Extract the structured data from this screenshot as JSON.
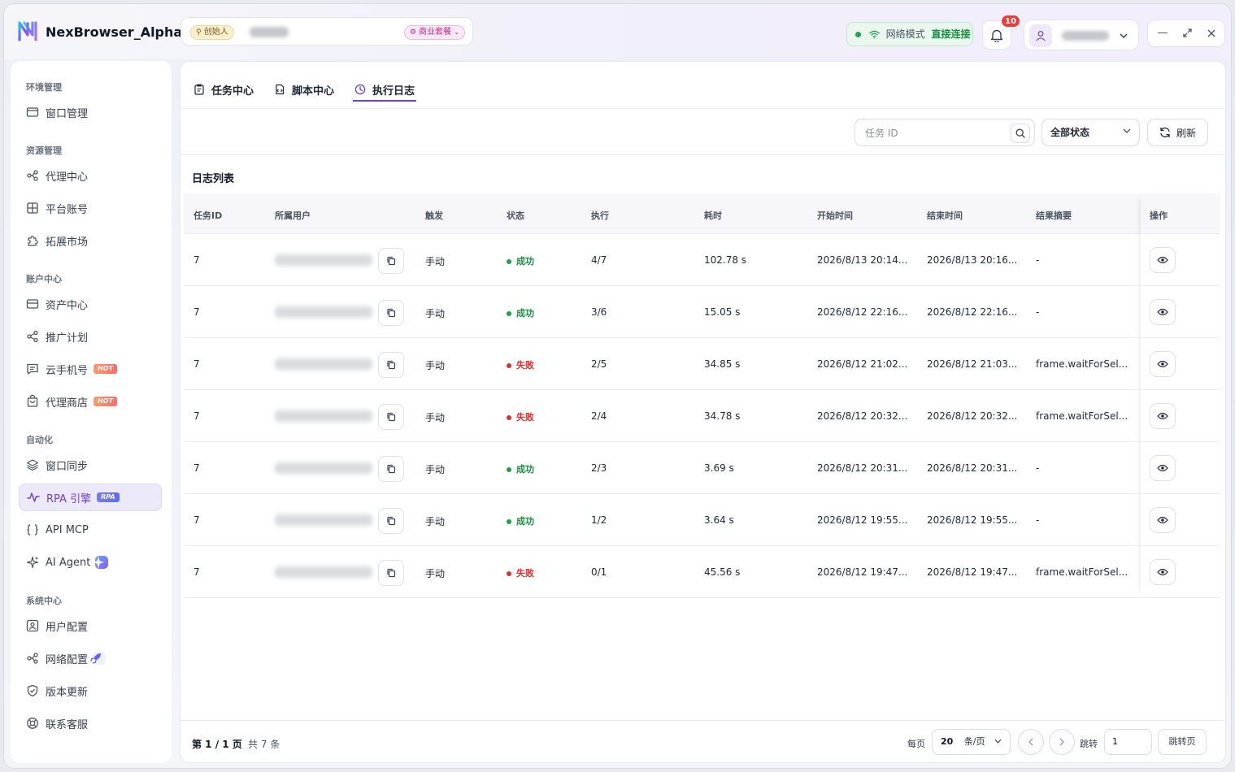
{
  "app": {
    "title": "NexBrowser_Alpha",
    "founder_badge": "创始人",
    "plan_badge": "商业套餐",
    "network_label": "网络模式",
    "network_value": "直接连接",
    "notifications_count": "10"
  },
  "sidebar": {
    "sections": [
      {
        "label": "环境管理",
        "items": [
          {
            "label": "窗口管理",
            "icon": "window-icon"
          }
        ]
      },
      {
        "label": "资源管理",
        "items": [
          {
            "label": "代理中心",
            "icon": "proxy-icon"
          },
          {
            "label": "平台账号",
            "icon": "grid-icon"
          },
          {
            "label": "拓展市场",
            "icon": "puzzle-icon"
          }
        ]
      },
      {
        "label": "账户中心",
        "items": [
          {
            "label": "资产中心",
            "icon": "wallet-icon"
          },
          {
            "label": "推广计划",
            "icon": "share-icon"
          },
          {
            "label": "云手机号",
            "icon": "message-icon",
            "tag": "HOT"
          },
          {
            "label": "代理商店",
            "icon": "store-icon",
            "tag": "HOT"
          }
        ]
      },
      {
        "label": "自动化",
        "items": [
          {
            "label": "窗口同步",
            "icon": "layers-icon"
          },
          {
            "label": "RPA 引擎",
            "icon": "pulse-icon",
            "tag": "RPA",
            "active": true
          },
          {
            "label": "API MCP",
            "icon": "braces-icon"
          },
          {
            "label": "AI Agent",
            "icon": "sparkle-icon"
          }
        ]
      },
      {
        "label": "系统中心",
        "items": [
          {
            "label": "用户配置",
            "icon": "user-settings-icon"
          },
          {
            "label": "网络配置",
            "icon": "network-icon"
          },
          {
            "label": "版本更新",
            "icon": "shield-check-icon"
          },
          {
            "label": "联系客服",
            "icon": "support-icon"
          }
        ]
      }
    ]
  },
  "tabs": [
    {
      "label": "任务中心",
      "icon": "clipboard-icon"
    },
    {
      "label": "脚本中心",
      "icon": "script-icon"
    },
    {
      "label": "执行日志",
      "icon": "clock-icon",
      "active": true
    }
  ],
  "toolbar": {
    "search_placeholder": "任务 ID",
    "status_filter": "全部状态",
    "refresh_label": "刷新"
  },
  "list": {
    "title": "日志列表",
    "columns": [
      "任务ID",
      "所属用户",
      "触发",
      "状态",
      "执行",
      "耗时",
      "开始时间",
      "结束时间",
      "结果摘要",
      "操作"
    ],
    "rows": [
      {
        "task_id": "7",
        "trigger": "手动",
        "status": "成功",
        "status_type": "ok",
        "exec": "4/7",
        "duration": "102.78 s",
        "start": "2026/8/13 20:14...",
        "end": "2026/8/13 20:16...",
        "summary": "-"
      },
      {
        "task_id": "7",
        "trigger": "手动",
        "status": "成功",
        "status_type": "ok",
        "exec": "3/6",
        "duration": "15.05 s",
        "start": "2026/8/12 22:16...",
        "end": "2026/8/12 22:16...",
        "summary": "-"
      },
      {
        "task_id": "7",
        "trigger": "手动",
        "status": "失败",
        "status_type": "fail",
        "exec": "2/5",
        "duration": "34.85 s",
        "start": "2026/8/12 21:02...",
        "end": "2026/8/12 21:03...",
        "summary": "frame.waitForSel..."
      },
      {
        "task_id": "7",
        "trigger": "手动",
        "status": "失败",
        "status_type": "fail",
        "exec": "2/4",
        "duration": "34.78 s",
        "start": "2026/8/12 20:32...",
        "end": "2026/8/12 20:32...",
        "summary": "frame.waitForSel..."
      },
      {
        "task_id": "7",
        "trigger": "手动",
        "status": "成功",
        "status_type": "ok",
        "exec": "2/3",
        "duration": "3.69 s",
        "start": "2026/8/12 20:31...",
        "end": "2026/8/12 20:31...",
        "summary": "-"
      },
      {
        "task_id": "7",
        "trigger": "手动",
        "status": "成功",
        "status_type": "ok",
        "exec": "1/2",
        "duration": "3.64 s",
        "start": "2026/8/12 19:55...",
        "end": "2026/8/12 19:55...",
        "summary": "-"
      },
      {
        "task_id": "7",
        "trigger": "手动",
        "status": "失败",
        "status_type": "fail",
        "exec": "0/1",
        "duration": "45.56 s",
        "start": "2026/8/12 19:47...",
        "end": "2026/8/12 19:47...",
        "summary": "frame.waitForSel..."
      }
    ]
  },
  "pagination": {
    "page_info": "第 1 / 1 页",
    "total": "共 7 条",
    "per_page_label": "每页",
    "per_page_value": "20",
    "per_page_unit": "条/页",
    "jump_label": "跳转",
    "jump_value": "1",
    "jump_button": "跳转页"
  },
  "colors": {
    "accent": "#6d3fd8",
    "success": "#16913f",
    "fail": "#e03131"
  }
}
